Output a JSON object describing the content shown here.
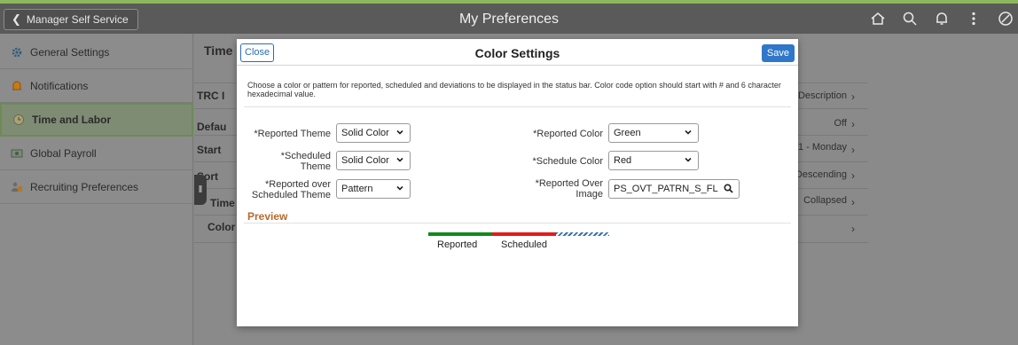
{
  "header": {
    "back_label": "Manager Self Service",
    "title": "My Preferences",
    "icons": [
      "home-icon",
      "search-icon",
      "bell-icon",
      "more-icon",
      "compass-icon"
    ]
  },
  "sidebar": {
    "items": [
      {
        "label": "General Settings",
        "icon": "gear-icon"
      },
      {
        "label": "Notifications",
        "icon": "bell-icon"
      },
      {
        "label": "Time and Labor",
        "icon": "clock-icon",
        "active": true
      },
      {
        "label": "Global Payroll",
        "icon": "payroll-icon"
      },
      {
        "label": "Recruiting Preferences",
        "icon": "recruiting-icon"
      }
    ]
  },
  "background": {
    "section_title": "Time",
    "row_labels": [
      "TRC I",
      "Defau",
      "Start",
      "Sort",
      "Time",
      "Color"
    ],
    "row_values": [
      "Description",
      "Off",
      "1 - Monday",
      "Descending",
      "Collapsed",
      ""
    ]
  },
  "modal": {
    "close_label": "Close",
    "title": "Color Settings",
    "save_label": "Save",
    "instructions": "Choose a color or pattern for reported, scheduled and deviations to be displayed in the status bar. Color code option should start with # and 6 character hexadecimal value.",
    "fields": {
      "reported_theme": {
        "label": "*Reported Theme",
        "value": "Solid Color"
      },
      "scheduled_theme": {
        "label_line1": "*Scheduled",
        "label_line2": "Theme",
        "value": "Solid Color"
      },
      "reported_over_scheduled_theme": {
        "label_line1": "*Reported over",
        "label_line2": "Scheduled Theme",
        "value": "Pattern"
      },
      "reported_color": {
        "label": "*Reported Color",
        "value": "Green"
      },
      "schedule_color": {
        "label": "*Schedule Color",
        "value": "Red"
      },
      "reported_over_image": {
        "label_line1": "*Reported Over",
        "label_line2": "Image",
        "value": "PS_OVT_PATRN_S_FL"
      }
    },
    "preview": {
      "title": "Preview",
      "legend_reported": "Reported",
      "legend_scheduled": "Scheduled"
    }
  },
  "colors": {
    "header_bg": "#5a5a5a",
    "accent": "#8cb85c",
    "save_button": "#2f77c9",
    "preview_title": "#b8692b",
    "reported_bar": "#118a1c",
    "scheduled_bar": "#e21c1c",
    "pattern_bar": "#3470a8"
  }
}
